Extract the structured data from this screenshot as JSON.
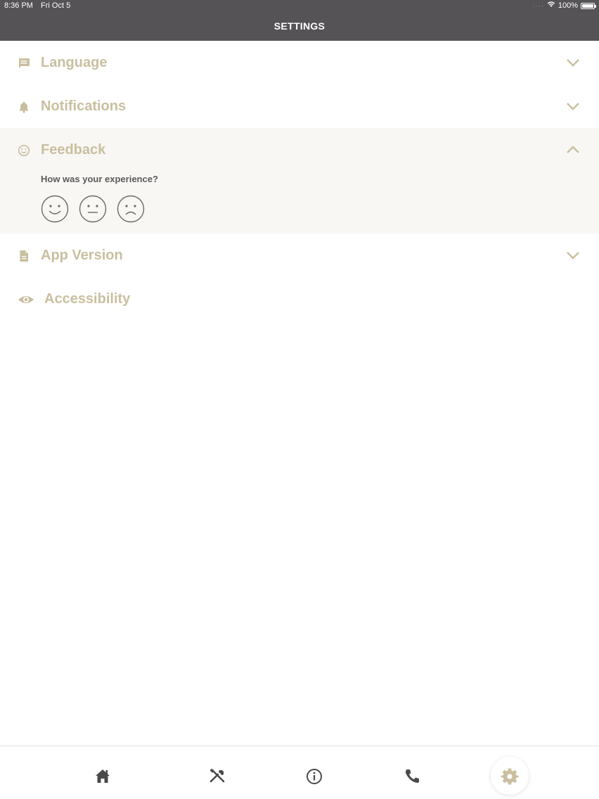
{
  "status_bar": {
    "time": "8:36 PM",
    "date": "Fri Oct 5",
    "battery": "100%",
    "battery_level": 1.0
  },
  "nav": {
    "title": "SETTINGS"
  },
  "sections": [
    {
      "id": "language",
      "label": "Language",
      "icon": "message-icon",
      "expanded": false
    },
    {
      "id": "notifications",
      "label": "Notifications",
      "icon": "bell-icon",
      "expanded": false
    },
    {
      "id": "feedback",
      "label": "Feedback",
      "icon": "smiley-icon",
      "expanded": true,
      "question": "How was your experience?",
      "options": [
        "happy-face-icon",
        "neutral-face-icon",
        "sad-face-icon"
      ]
    },
    {
      "id": "app-version",
      "label": "App Version",
      "icon": "document-icon",
      "expanded": false
    },
    {
      "id": "accessibility",
      "label": "Accessibility",
      "icon": "eye-icon",
      "expanded": false
    }
  ],
  "tabs": [
    {
      "id": "home",
      "icon": "home-icon",
      "active": false
    },
    {
      "id": "tools",
      "icon": "tools-icon",
      "active": false
    },
    {
      "id": "info",
      "icon": "info-icon",
      "active": false
    },
    {
      "id": "phone",
      "icon": "phone-icon",
      "active": false
    },
    {
      "id": "settings",
      "icon": "gear-icon",
      "active": true
    }
  ],
  "colors": {
    "header_bg": "#555356",
    "accent": "#c9bf9f",
    "expanded_bg": "#f9f7f4",
    "tab_icon": "#4a4a4a"
  }
}
